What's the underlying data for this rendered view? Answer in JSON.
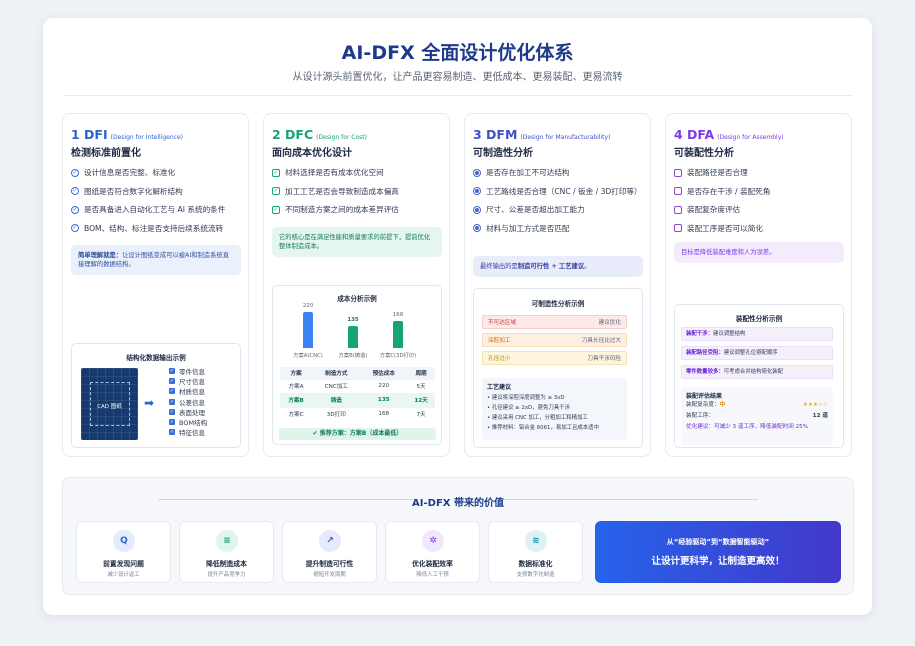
{
  "header": {
    "title": "AI-DFX 全面设计优化体系",
    "subtitle": "从设计源头前置优化，让产品更容易制造、更低成本、更易装配、更易流转"
  },
  "colors": {
    "dfi": "#2b62d1",
    "dfc": "#16a37a",
    "dfm": "#3f51c5",
    "dfa": "#7c3aed"
  },
  "cards": [
    {
      "num": "1 DFI",
      "eng": "(Design for Intelligence)",
      "sub": "检测标准前置化",
      "items": [
        "设计信息是否完整、标准化",
        "图纸是否符合数字化解析结构",
        "是否具备进入自动化工艺与 AI 系统的条件",
        "BOM、结构、标注是否支持后续系统流转"
      ],
      "note_bold": "简单理解就是：",
      "note": "让设计图纸变成可以被AI和制造系统直接理解的数据结构。",
      "panel_title": "结构化数据输出示例",
      "cad_label": "CAD 图纸",
      "checks": [
        "零件信息",
        "尺寸信息",
        "材质信息",
        "公差信息",
        "表面处理",
        "BOM结构",
        "特征信息"
      ]
    },
    {
      "num": "2 DFC",
      "eng": "(Design for Cost)",
      "sub": "面向成本优化设计",
      "items": [
        "材料选择是否有成本优化空间",
        "加工工艺是否会导致制造成本偏高",
        "不同制造方案之间的成本差异评估"
      ],
      "note": "它的核心是在满足性能和质量要求的前提下，提前优化整体制造成本。",
      "panel_title": "成本分析示例",
      "table_head": [
        "方案",
        "制造方式",
        "预估成本",
        "周期"
      ],
      "table_rows": [
        [
          "方案A",
          "CNC加工",
          "220",
          "5天"
        ],
        [
          "方案B",
          "铸造",
          "135",
          "12天"
        ],
        [
          "方案C",
          "3D打印",
          "168",
          "7天"
        ]
      ],
      "recommend": "推荐方案：方案B（成本最低）"
    },
    {
      "num": "3 DFM",
      "eng": "(Design for Manufacturability)",
      "sub": "可制造性分析",
      "items": [
        "是否存在加工不可达结构",
        "工艺路线是否合理（CNC / 钣金 / 3D打印等）",
        "尺寸、公差是否超出加工能力",
        "材料与加工方式是否匹配"
      ],
      "note": "最终输出的是制造可行性 + 工艺建议。",
      "note_pre": "最终输出的是",
      "note_hl": "制造可行性 + 工艺建议",
      "note_post": "。",
      "panel_title": "可制造性分析示例",
      "issues": [
        [
          "不可达区域",
          "建议优化"
        ],
        [
          "深腔加工",
          "刀具长径比过大"
        ],
        [
          "孔径过小",
          "刀具干涉风险"
        ]
      ],
      "sug_title": "工艺建议",
      "sug": [
        "• 建议将深腔深度调整为 ≤ 3xD",
        "• 孔径建议 ≥ 2xD，避免刀具干涉",
        "• 建议采用 CNC 加工，分粗加工和精加工",
        "• 推荐材料：铝合金 6061，易加工且成本适中"
      ]
    },
    {
      "num": "4 DFA",
      "eng": "(Design for Assembly)",
      "sub": "可装配性分析",
      "items": [
        "装配路径是否合理",
        "是否存在干涉 / 装配死角",
        "装配复杂度评估",
        "装配工序是否可以简化"
      ],
      "note": "目标是降低装配难度和人为误差。",
      "panel_title": "装配性分析示例",
      "rows": [
        [
          "装配干涉：",
          "建议调整结构"
        ],
        [
          "装配路径受阻：",
          "建议调整孔位避配顺序"
        ],
        [
          "零件数量较多：",
          "可考虑合并结构简化装配"
        ]
      ],
      "eval_title": "装配评估结果",
      "complex_label": "装配复杂度：",
      "complex_val": "中",
      "stars": "★★★☆☆",
      "steps_label": "装配工序：",
      "steps_val": "12 道",
      "opt_label": "优化建议：",
      "opt": "可减少 3 道工序，降低装配时间 25%"
    }
  ],
  "chart_data": {
    "type": "bar",
    "title": "成本分析示例",
    "categories": [
      "方案A(CNC)",
      "方案B(铸造)",
      "方案C(3D打印)"
    ],
    "values": [
      220,
      135,
      168
    ],
    "ylim": [
      0,
      240
    ]
  },
  "value": {
    "title": "AI-DFX 带来的价值",
    "cards": [
      {
        "icon": "Q",
        "title": "前置发现问题",
        "sub": "减少设计返工"
      },
      {
        "icon": "≡",
        "title": "降低制造成本",
        "sub": "提升产品竞争力"
      },
      {
        "icon": "↗",
        "title": "提升制造可行性",
        "sub": "缩短开发周期"
      },
      {
        "icon": "✲",
        "title": "优化装配效率",
        "sub": "降低人工干预"
      },
      {
        "icon": "≋",
        "title": "数据标准化",
        "sub": "支撑数字化制造"
      }
    ],
    "hero_a": "从“经验驱动”到“数据智能驱动”",
    "hero_b": "让设计更科学，让制造更高效！"
  }
}
